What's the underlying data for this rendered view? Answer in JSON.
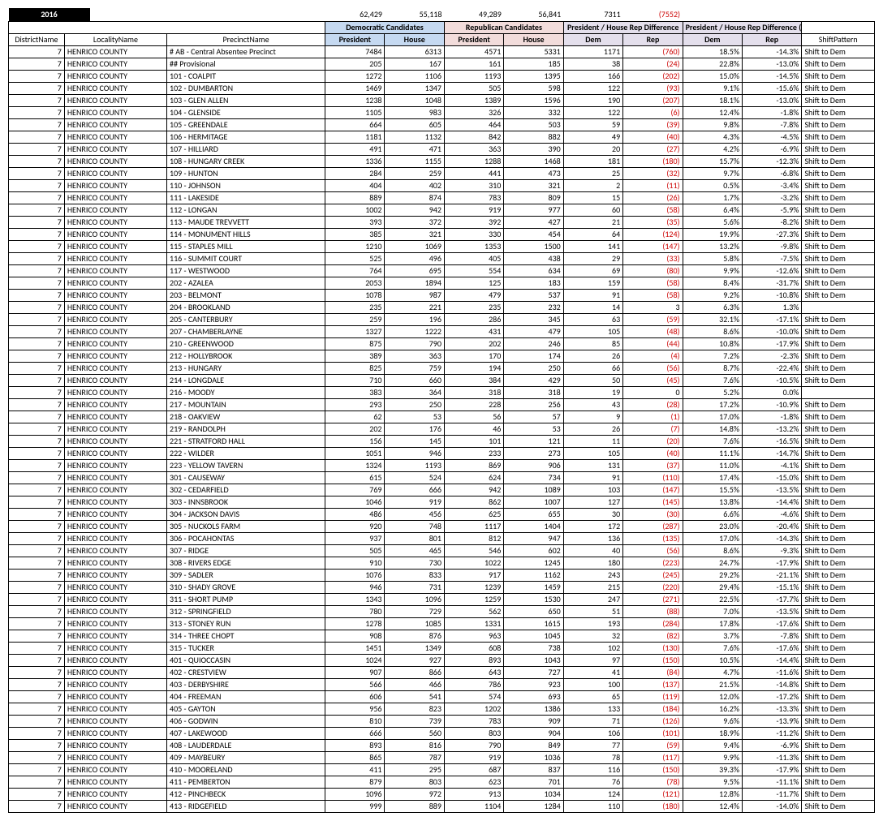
{
  "year": "2016",
  "totals": {
    "dem_president": "62,429",
    "dem_house": "55,118",
    "rep_president": "49,289",
    "rep_house": "56,841",
    "diff_dem": "7311",
    "diff_rep": "(7552)"
  },
  "group_headers": {
    "dem": "Democratic Candidates",
    "rep": "Republican Candidates",
    "diff": "President / House Rep Difference",
    "pct": "President / House Rep Difference (%)"
  },
  "col_headers": {
    "district": "DistrictName",
    "locality": "LocalityName",
    "precinct": "PrecinctName",
    "president": "President",
    "house": "House",
    "dem": "Dem",
    "rep": "Rep",
    "shift": "ShiftPattern"
  },
  "rows": [
    {
      "d": "7",
      "l": "HENRICO COUNTY",
      "p": "# AB - Central Absentee Precinct",
      "dp": "7484",
      "dh": "6313",
      "rp": "4571",
      "rh": "5331",
      "dd": "1171",
      "dr": "(760)",
      "pd": "18.5%",
      "pr": "-14.3%",
      "s": "Shift to Dem"
    },
    {
      "d": "7",
      "l": "HENRICO COUNTY",
      "p": "## Provisional",
      "dp": "205",
      "dh": "167",
      "rp": "161",
      "rh": "185",
      "dd": "38",
      "dr": "(24)",
      "pd": "22.8%",
      "pr": "-13.0%",
      "s": "Shift to Dem"
    },
    {
      "d": "7",
      "l": "HENRICO COUNTY",
      "p": "101 - COALPIT",
      "dp": "1272",
      "dh": "1106",
      "rp": "1193",
      "rh": "1395",
      "dd": "166",
      "dr": "(202)",
      "pd": "15.0%",
      "pr": "-14.5%",
      "s": "Shift to Dem"
    },
    {
      "d": "7",
      "l": "HENRICO COUNTY",
      "p": "102 - DUMBARTON",
      "dp": "1469",
      "dh": "1347",
      "rp": "505",
      "rh": "598",
      "dd": "122",
      "dr": "(93)",
      "pd": "9.1%",
      "pr": "-15.6%",
      "s": "Shift to Dem"
    },
    {
      "d": "7",
      "l": "HENRICO COUNTY",
      "p": "103 - GLEN ALLEN",
      "dp": "1238",
      "dh": "1048",
      "rp": "1389",
      "rh": "1596",
      "dd": "190",
      "dr": "(207)",
      "pd": "18.1%",
      "pr": "-13.0%",
      "s": "Shift to Dem"
    },
    {
      "d": "7",
      "l": "HENRICO COUNTY",
      "p": "104 - GLENSIDE",
      "dp": "1105",
      "dh": "983",
      "rp": "326",
      "rh": "332",
      "dd": "122",
      "dr": "(6)",
      "pd": "12.4%",
      "pr": "-1.8%",
      "s": "Shift to Dem"
    },
    {
      "d": "7",
      "l": "HENRICO COUNTY",
      "p": "105 - GREENDALE",
      "dp": "664",
      "dh": "605",
      "rp": "464",
      "rh": "503",
      "dd": "59",
      "dr": "(39)",
      "pd": "9.8%",
      "pr": "-7.8%",
      "s": "Shift to Dem"
    },
    {
      "d": "7",
      "l": "HENRICO COUNTY",
      "p": "106 - HERMITAGE",
      "dp": "1181",
      "dh": "1132",
      "rp": "842",
      "rh": "882",
      "dd": "49",
      "dr": "(40)",
      "pd": "4.3%",
      "pr": "-4.5%",
      "s": "Shift to Dem"
    },
    {
      "d": "7",
      "l": "HENRICO COUNTY",
      "p": "107 - HILLIARD",
      "dp": "491",
      "dh": "471",
      "rp": "363",
      "rh": "390",
      "dd": "20",
      "dr": "(27)",
      "pd": "4.2%",
      "pr": "-6.9%",
      "s": "Shift to Dem"
    },
    {
      "d": "7",
      "l": "HENRICO COUNTY",
      "p": "108 - HUNGARY CREEK",
      "dp": "1336",
      "dh": "1155",
      "rp": "1288",
      "rh": "1468",
      "dd": "181",
      "dr": "(180)",
      "pd": "15.7%",
      "pr": "-12.3%",
      "s": "Shift to Dem"
    },
    {
      "d": "7",
      "l": "HENRICO COUNTY",
      "p": "109 - HUNTON",
      "dp": "284",
      "dh": "259",
      "rp": "441",
      "rh": "473",
      "dd": "25",
      "dr": "(32)",
      "pd": "9.7%",
      "pr": "-6.8%",
      "s": "Shift to Dem"
    },
    {
      "d": "7",
      "l": "HENRICO COUNTY",
      "p": "110 - JOHNSON",
      "dp": "404",
      "dh": "402",
      "rp": "310",
      "rh": "321",
      "dd": "2",
      "dr": "(11)",
      "pd": "0.5%",
      "pr": "-3.4%",
      "s": "Shift to Dem"
    },
    {
      "d": "7",
      "l": "HENRICO COUNTY",
      "p": "111 - LAKESIDE",
      "dp": "889",
      "dh": "874",
      "rp": "783",
      "rh": "809",
      "dd": "15",
      "dr": "(26)",
      "pd": "1.7%",
      "pr": "-3.2%",
      "s": "Shift to Dem"
    },
    {
      "d": "7",
      "l": "HENRICO COUNTY",
      "p": "112 - LONGAN",
      "dp": "1002",
      "dh": "942",
      "rp": "919",
      "rh": "977",
      "dd": "60",
      "dr": "(58)",
      "pd": "6.4%",
      "pr": "-5.9%",
      "s": "Shift to Dem"
    },
    {
      "d": "7",
      "l": "HENRICO COUNTY",
      "p": "113 - MAUDE TREVVETT",
      "dp": "393",
      "dh": "372",
      "rp": "392",
      "rh": "427",
      "dd": "21",
      "dr": "(35)",
      "pd": "5.6%",
      "pr": "-8.2%",
      "s": "Shift to Dem"
    },
    {
      "d": "7",
      "l": "HENRICO COUNTY",
      "p": "114 - MONUMENT HILLS",
      "dp": "385",
      "dh": "321",
      "rp": "330",
      "rh": "454",
      "dd": "64",
      "dr": "(124)",
      "pd": "19.9%",
      "pr": "-27.3%",
      "s": "Shift to Dem"
    },
    {
      "d": "7",
      "l": "HENRICO COUNTY",
      "p": "115 - STAPLES MILL",
      "dp": "1210",
      "dh": "1069",
      "rp": "1353",
      "rh": "1500",
      "dd": "141",
      "dr": "(147)",
      "pd": "13.2%",
      "pr": "-9.8%",
      "s": "Shift to Dem"
    },
    {
      "d": "7",
      "l": "HENRICO COUNTY",
      "p": "116 - SUMMIT COURT",
      "dp": "525",
      "dh": "496",
      "rp": "405",
      "rh": "438",
      "dd": "29",
      "dr": "(33)",
      "pd": "5.8%",
      "pr": "-7.5%",
      "s": "Shift to Dem"
    },
    {
      "d": "7",
      "l": "HENRICO COUNTY",
      "p": "117 - WESTWOOD",
      "dp": "764",
      "dh": "695",
      "rp": "554",
      "rh": "634",
      "dd": "69",
      "dr": "(80)",
      "pd": "9.9%",
      "pr": "-12.6%",
      "s": "Shift to Dem"
    },
    {
      "d": "7",
      "l": "HENRICO COUNTY",
      "p": "202 - AZALEA",
      "dp": "2053",
      "dh": "1894",
      "rp": "125",
      "rh": "183",
      "dd": "159",
      "dr": "(58)",
      "pd": "8.4%",
      "pr": "-31.7%",
      "s": "Shift to Dem"
    },
    {
      "d": "7",
      "l": "HENRICO COUNTY",
      "p": "203 - BELMONT",
      "dp": "1078",
      "dh": "987",
      "rp": "479",
      "rh": "537",
      "dd": "91",
      "dr": "(58)",
      "pd": "9.2%",
      "pr": "-10.8%",
      "s": "Shift to Dem"
    },
    {
      "d": "7",
      "l": "HENRICO COUNTY",
      "p": "204 - BROOKLAND",
      "dp": "235",
      "dh": "221",
      "rp": "235",
      "rh": "232",
      "dd": "14",
      "dr": "3",
      "pd": "6.3%",
      "pr": "1.3%",
      "s": ""
    },
    {
      "d": "7",
      "l": "HENRICO COUNTY",
      "p": "205 - CANTERBURY",
      "dp": "259",
      "dh": "196",
      "rp": "286",
      "rh": "345",
      "dd": "63",
      "dr": "(59)",
      "pd": "32.1%",
      "pr": "-17.1%",
      "s": "Shift to Dem"
    },
    {
      "d": "7",
      "l": "HENRICO COUNTY",
      "p": "207 - CHAMBERLAYNE",
      "dp": "1327",
      "dh": "1222",
      "rp": "431",
      "rh": "479",
      "dd": "105",
      "dr": "(48)",
      "pd": "8.6%",
      "pr": "-10.0%",
      "s": "Shift to Dem"
    },
    {
      "d": "7",
      "l": "HENRICO COUNTY",
      "p": "210 - GREENWOOD",
      "dp": "875",
      "dh": "790",
      "rp": "202",
      "rh": "246",
      "dd": "85",
      "dr": "(44)",
      "pd": "10.8%",
      "pr": "-17.9%",
      "s": "Shift to Dem"
    },
    {
      "d": "7",
      "l": "HENRICO COUNTY",
      "p": "212 - HOLLYBROOK",
      "dp": "389",
      "dh": "363",
      "rp": "170",
      "rh": "174",
      "dd": "26",
      "dr": "(4)",
      "pd": "7.2%",
      "pr": "-2.3%",
      "s": "Shift to Dem"
    },
    {
      "d": "7",
      "l": "HENRICO COUNTY",
      "p": "213 - HUNGARY",
      "dp": "825",
      "dh": "759",
      "rp": "194",
      "rh": "250",
      "dd": "66",
      "dr": "(56)",
      "pd": "8.7%",
      "pr": "-22.4%",
      "s": "Shift to Dem"
    },
    {
      "d": "7",
      "l": "HENRICO COUNTY",
      "p": "214 - LONGDALE",
      "dp": "710",
      "dh": "660",
      "rp": "384",
      "rh": "429",
      "dd": "50",
      "dr": "(45)",
      "pd": "7.6%",
      "pr": "-10.5%",
      "s": "Shift to Dem"
    },
    {
      "d": "7",
      "l": "HENRICO COUNTY",
      "p": "216 - MOODY",
      "dp": "383",
      "dh": "364",
      "rp": "318",
      "rh": "318",
      "dd": "19",
      "dr": "0",
      "pd": "5.2%",
      "pr": "0.0%",
      "s": ""
    },
    {
      "d": "7",
      "l": "HENRICO COUNTY",
      "p": "217 - MOUNTAIN",
      "dp": "293",
      "dh": "250",
      "rp": "228",
      "rh": "256",
      "dd": "43",
      "dr": "(28)",
      "pd": "17.2%",
      "pr": "-10.9%",
      "s": "Shift to Dem"
    },
    {
      "d": "7",
      "l": "HENRICO COUNTY",
      "p": "218 - OAKVIEW",
      "dp": "62",
      "dh": "53",
      "rp": "56",
      "rh": "57",
      "dd": "9",
      "dr": "(1)",
      "pd": "17.0%",
      "pr": "-1.8%",
      "s": "Shift to Dem"
    },
    {
      "d": "7",
      "l": "HENRICO COUNTY",
      "p": "219 - RANDOLPH",
      "dp": "202",
      "dh": "176",
      "rp": "46",
      "rh": "53",
      "dd": "26",
      "dr": "(7)",
      "pd": "14.8%",
      "pr": "-13.2%",
      "s": "Shift to Dem"
    },
    {
      "d": "7",
      "l": "HENRICO COUNTY",
      "p": "221 - STRATFORD HALL",
      "dp": "156",
      "dh": "145",
      "rp": "101",
      "rh": "121",
      "dd": "11",
      "dr": "(20)",
      "pd": "7.6%",
      "pr": "-16.5%",
      "s": "Shift to Dem"
    },
    {
      "d": "7",
      "l": "HENRICO COUNTY",
      "p": "222 - WILDER",
      "dp": "1051",
      "dh": "946",
      "rp": "233",
      "rh": "273",
      "dd": "105",
      "dr": "(40)",
      "pd": "11.1%",
      "pr": "-14.7%",
      "s": "Shift to Dem"
    },
    {
      "d": "7",
      "l": "HENRICO COUNTY",
      "p": "223 - YELLOW TAVERN",
      "dp": "1324",
      "dh": "1193",
      "rp": "869",
      "rh": "906",
      "dd": "131",
      "dr": "(37)",
      "pd": "11.0%",
      "pr": "-4.1%",
      "s": "Shift to Dem"
    },
    {
      "d": "7",
      "l": "HENRICO COUNTY",
      "p": "301 - CAUSEWAY",
      "dp": "615",
      "dh": "524",
      "rp": "624",
      "rh": "734",
      "dd": "91",
      "dr": "(110)",
      "pd": "17.4%",
      "pr": "-15.0%",
      "s": "Shift to Dem"
    },
    {
      "d": "7",
      "l": "HENRICO COUNTY",
      "p": "302 - CEDARFIELD",
      "dp": "769",
      "dh": "666",
      "rp": "942",
      "rh": "1089",
      "dd": "103",
      "dr": "(147)",
      "pd": "15.5%",
      "pr": "-13.5%",
      "s": "Shift to Dem"
    },
    {
      "d": "7",
      "l": "HENRICO COUNTY",
      "p": "303 - INNSBROOK",
      "dp": "1046",
      "dh": "919",
      "rp": "862",
      "rh": "1007",
      "dd": "127",
      "dr": "(145)",
      "pd": "13.8%",
      "pr": "-14.4%",
      "s": "Shift to Dem"
    },
    {
      "d": "7",
      "l": "HENRICO COUNTY",
      "p": "304 - JACKSON DAVIS",
      "dp": "486",
      "dh": "456",
      "rp": "625",
      "rh": "655",
      "dd": "30",
      "dr": "(30)",
      "pd": "6.6%",
      "pr": "-4.6%",
      "s": "Shift to Dem"
    },
    {
      "d": "7",
      "l": "HENRICO COUNTY",
      "p": "305 - NUCKOLS FARM",
      "dp": "920",
      "dh": "748",
      "rp": "1117",
      "rh": "1404",
      "dd": "172",
      "dr": "(287)",
      "pd": "23.0%",
      "pr": "-20.4%",
      "s": "Shift to Dem"
    },
    {
      "d": "7",
      "l": "HENRICO COUNTY",
      "p": "306 - POCAHONTAS",
      "dp": "937",
      "dh": "801",
      "rp": "812",
      "rh": "947",
      "dd": "136",
      "dr": "(135)",
      "pd": "17.0%",
      "pr": "-14.3%",
      "s": "Shift to Dem"
    },
    {
      "d": "7",
      "l": "HENRICO COUNTY",
      "p": "307 - RIDGE",
      "dp": "505",
      "dh": "465",
      "rp": "546",
      "rh": "602",
      "dd": "40",
      "dr": "(56)",
      "pd": "8.6%",
      "pr": "-9.3%",
      "s": "Shift to Dem"
    },
    {
      "d": "7",
      "l": "HENRICO COUNTY",
      "p": "308 - RIVERS EDGE",
      "dp": "910",
      "dh": "730",
      "rp": "1022",
      "rh": "1245",
      "dd": "180",
      "dr": "(223)",
      "pd": "24.7%",
      "pr": "-17.9%",
      "s": "Shift to Dem"
    },
    {
      "d": "7",
      "l": "HENRICO COUNTY",
      "p": "309 - SADLER",
      "dp": "1076",
      "dh": "833",
      "rp": "917",
      "rh": "1162",
      "dd": "243",
      "dr": "(245)",
      "pd": "29.2%",
      "pr": "-21.1%",
      "s": "Shift to Dem"
    },
    {
      "d": "7",
      "l": "HENRICO COUNTY",
      "p": "310 - SHADY GROVE",
      "dp": "946",
      "dh": "731",
      "rp": "1239",
      "rh": "1459",
      "dd": "215",
      "dr": "(220)",
      "pd": "29.4%",
      "pr": "-15.1%",
      "s": "Shift to Dem"
    },
    {
      "d": "7",
      "l": "HENRICO COUNTY",
      "p": "311 - SHORT PUMP",
      "dp": "1343",
      "dh": "1096",
      "rp": "1259",
      "rh": "1530",
      "dd": "247",
      "dr": "(271)",
      "pd": "22.5%",
      "pr": "-17.7%",
      "s": "Shift to Dem"
    },
    {
      "d": "7",
      "l": "HENRICO COUNTY",
      "p": "312 - SPRINGFIELD",
      "dp": "780",
      "dh": "729",
      "rp": "562",
      "rh": "650",
      "dd": "51",
      "dr": "(88)",
      "pd": "7.0%",
      "pr": "-13.5%",
      "s": "Shift to Dem"
    },
    {
      "d": "7",
      "l": "HENRICO COUNTY",
      "p": "313 - STONEY RUN",
      "dp": "1278",
      "dh": "1085",
      "rp": "1331",
      "rh": "1615",
      "dd": "193",
      "dr": "(284)",
      "pd": "17.8%",
      "pr": "-17.6%",
      "s": "Shift to Dem"
    },
    {
      "d": "7",
      "l": "HENRICO COUNTY",
      "p": "314 - THREE CHOPT",
      "dp": "908",
      "dh": "876",
      "rp": "963",
      "rh": "1045",
      "dd": "32",
      "dr": "(82)",
      "pd": "3.7%",
      "pr": "-7.8%",
      "s": "Shift to Dem"
    },
    {
      "d": "7",
      "l": "HENRICO COUNTY",
      "p": "315 - TUCKER",
      "dp": "1451",
      "dh": "1349",
      "rp": "608",
      "rh": "738",
      "dd": "102",
      "dr": "(130)",
      "pd": "7.6%",
      "pr": "-17.6%",
      "s": "Shift to Dem"
    },
    {
      "d": "7",
      "l": "HENRICO COUNTY",
      "p": "401 - QUIOCCASIN",
      "dp": "1024",
      "dh": "927",
      "rp": "893",
      "rh": "1043",
      "dd": "97",
      "dr": "(150)",
      "pd": "10.5%",
      "pr": "-14.4%",
      "s": "Shift to Dem"
    },
    {
      "d": "7",
      "l": "HENRICO COUNTY",
      "p": "402 - CRESTVIEW",
      "dp": "907",
      "dh": "866",
      "rp": "643",
      "rh": "727",
      "dd": "41",
      "dr": "(84)",
      "pd": "4.7%",
      "pr": "-11.6%",
      "s": "Shift to Dem"
    },
    {
      "d": "7",
      "l": "HENRICO COUNTY",
      "p": "403 - DERBYSHIRE",
      "dp": "566",
      "dh": "466",
      "rp": "786",
      "rh": "923",
      "dd": "100",
      "dr": "(137)",
      "pd": "21.5%",
      "pr": "-14.8%",
      "s": "Shift to Dem"
    },
    {
      "d": "7",
      "l": "HENRICO COUNTY",
      "p": "404 - FREEMAN",
      "dp": "606",
      "dh": "541",
      "rp": "574",
      "rh": "693",
      "dd": "65",
      "dr": "(119)",
      "pd": "12.0%",
      "pr": "-17.2%",
      "s": "Shift to Dem"
    },
    {
      "d": "7",
      "l": "HENRICO COUNTY",
      "p": "405 - GAYTON",
      "dp": "956",
      "dh": "823",
      "rp": "1202",
      "rh": "1386",
      "dd": "133",
      "dr": "(184)",
      "pd": "16.2%",
      "pr": "-13.3%",
      "s": "Shift to Dem"
    },
    {
      "d": "7",
      "l": "HENRICO COUNTY",
      "p": "406 - GODWIN",
      "dp": "810",
      "dh": "739",
      "rp": "783",
      "rh": "909",
      "dd": "71",
      "dr": "(126)",
      "pd": "9.6%",
      "pr": "-13.9%",
      "s": "Shift to Dem"
    },
    {
      "d": "7",
      "l": "HENRICO COUNTY",
      "p": "407 - LAKEWOOD",
      "dp": "666",
      "dh": "560",
      "rp": "803",
      "rh": "904",
      "dd": "106",
      "dr": "(101)",
      "pd": "18.9%",
      "pr": "-11.2%",
      "s": "Shift to Dem"
    },
    {
      "d": "7",
      "l": "HENRICO COUNTY",
      "p": "408 - LAUDERDALE",
      "dp": "893",
      "dh": "816",
      "rp": "790",
      "rh": "849",
      "dd": "77",
      "dr": "(59)",
      "pd": "9.4%",
      "pr": "-6.9%",
      "s": "Shift to Dem"
    },
    {
      "d": "7",
      "l": "HENRICO COUNTY",
      "p": "409 - MAYBEURY",
      "dp": "865",
      "dh": "787",
      "rp": "919",
      "rh": "1036",
      "dd": "78",
      "dr": "(117)",
      "pd": "9.9%",
      "pr": "-11.3%",
      "s": "Shift to Dem"
    },
    {
      "d": "7",
      "l": "HENRICO COUNTY",
      "p": "410 - MOORELAND",
      "dp": "411",
      "dh": "295",
      "rp": "687",
      "rh": "837",
      "dd": "116",
      "dr": "(150)",
      "pd": "39.3%",
      "pr": "-17.9%",
      "s": "Shift to Dem"
    },
    {
      "d": "7",
      "l": "HENRICO COUNTY",
      "p": "411 - PEMBERTON",
      "dp": "879",
      "dh": "803",
      "rp": "623",
      "rh": "701",
      "dd": "76",
      "dr": "(78)",
      "pd": "9.5%",
      "pr": "-11.1%",
      "s": "Shift to Dem"
    },
    {
      "d": "7",
      "l": "HENRICO COUNTY",
      "p": "412 - PINCHBECK",
      "dp": "1096",
      "dh": "972",
      "rp": "913",
      "rh": "1034",
      "dd": "124",
      "dr": "(121)",
      "pd": "12.8%",
      "pr": "-11.7%",
      "s": "Shift to Dem"
    },
    {
      "d": "7",
      "l": "HENRICO COUNTY",
      "p": "413 - RIDGEFIELD",
      "dp": "999",
      "dh": "889",
      "rp": "1104",
      "rh": "1284",
      "dd": "110",
      "dr": "(180)",
      "pd": "12.4%",
      "pr": "-14.0%",
      "s": "Shift to Dem"
    }
  ]
}
